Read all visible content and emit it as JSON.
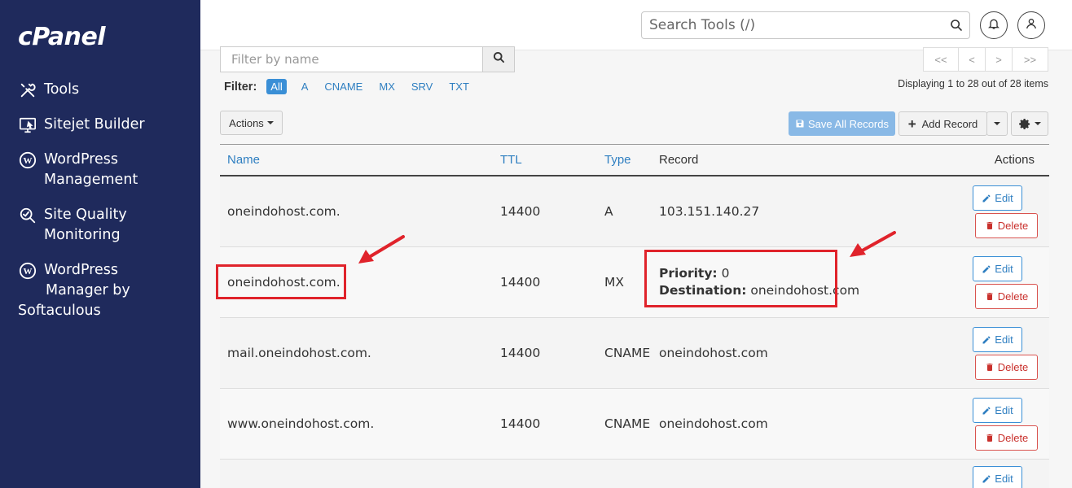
{
  "sidebar": {
    "logo": "cPanel",
    "items": [
      {
        "label": "Tools",
        "icon": "tools-icon"
      },
      {
        "label": "Sitejet Builder",
        "icon": "sitejet-icon"
      },
      {
        "line1": "WordPress",
        "line2": "Management",
        "icon": "wordpress-icon"
      },
      {
        "line1": "Site Quality",
        "line2": "Monitoring",
        "icon": "site-quality-icon"
      },
      {
        "line1": "WordPress",
        "line2": "Manager by",
        "line3": "Softaculous",
        "icon": "wordpress-icon"
      }
    ]
  },
  "header": {
    "search_placeholder": "Search Tools (/)"
  },
  "filter": {
    "placeholder": "Filter by name",
    "label": "Filter:",
    "options": [
      "All",
      "A",
      "CNAME",
      "MX",
      "SRV",
      "TXT"
    ],
    "active": "All"
  },
  "pager": {
    "first": "<<",
    "prev": "<",
    "next": ">",
    "last": ">>",
    "display": "Displaying 1 to 28 out of 28 items"
  },
  "toolbar": {
    "actions_label": "Actions",
    "save_label": "Save All Records",
    "add_label": "Add Record"
  },
  "table": {
    "columns": {
      "name": "Name",
      "ttl": "TTL",
      "type": "Type",
      "record": "Record",
      "actions": "Actions"
    },
    "edit_label": "Edit",
    "delete_label": "Delete",
    "rows": [
      {
        "name": "oneindohost.com.",
        "ttl": "14400",
        "type": "A",
        "record": "103.151.140.27"
      },
      {
        "name": "oneindohost.com.",
        "ttl": "14400",
        "type": "MX",
        "priority_label": "Priority:",
        "priority": "0",
        "dest_label": "Destination:",
        "destination": "oneindohost.com"
      },
      {
        "name": "mail.oneindohost.com.",
        "ttl": "14400",
        "type": "CNAME",
        "record": "oneindohost.com"
      },
      {
        "name": "www.oneindohost.com.",
        "ttl": "14400",
        "type": "CNAME",
        "record": "oneindohost.com"
      },
      {
        "name": "",
        "ttl": "",
        "type": "",
        "record": ""
      }
    ]
  },
  "colors": {
    "sidebar_bg": "#1f2a5c",
    "link": "#2f7fc1",
    "delete": "#d9534f",
    "highlight": "#e0232b"
  }
}
